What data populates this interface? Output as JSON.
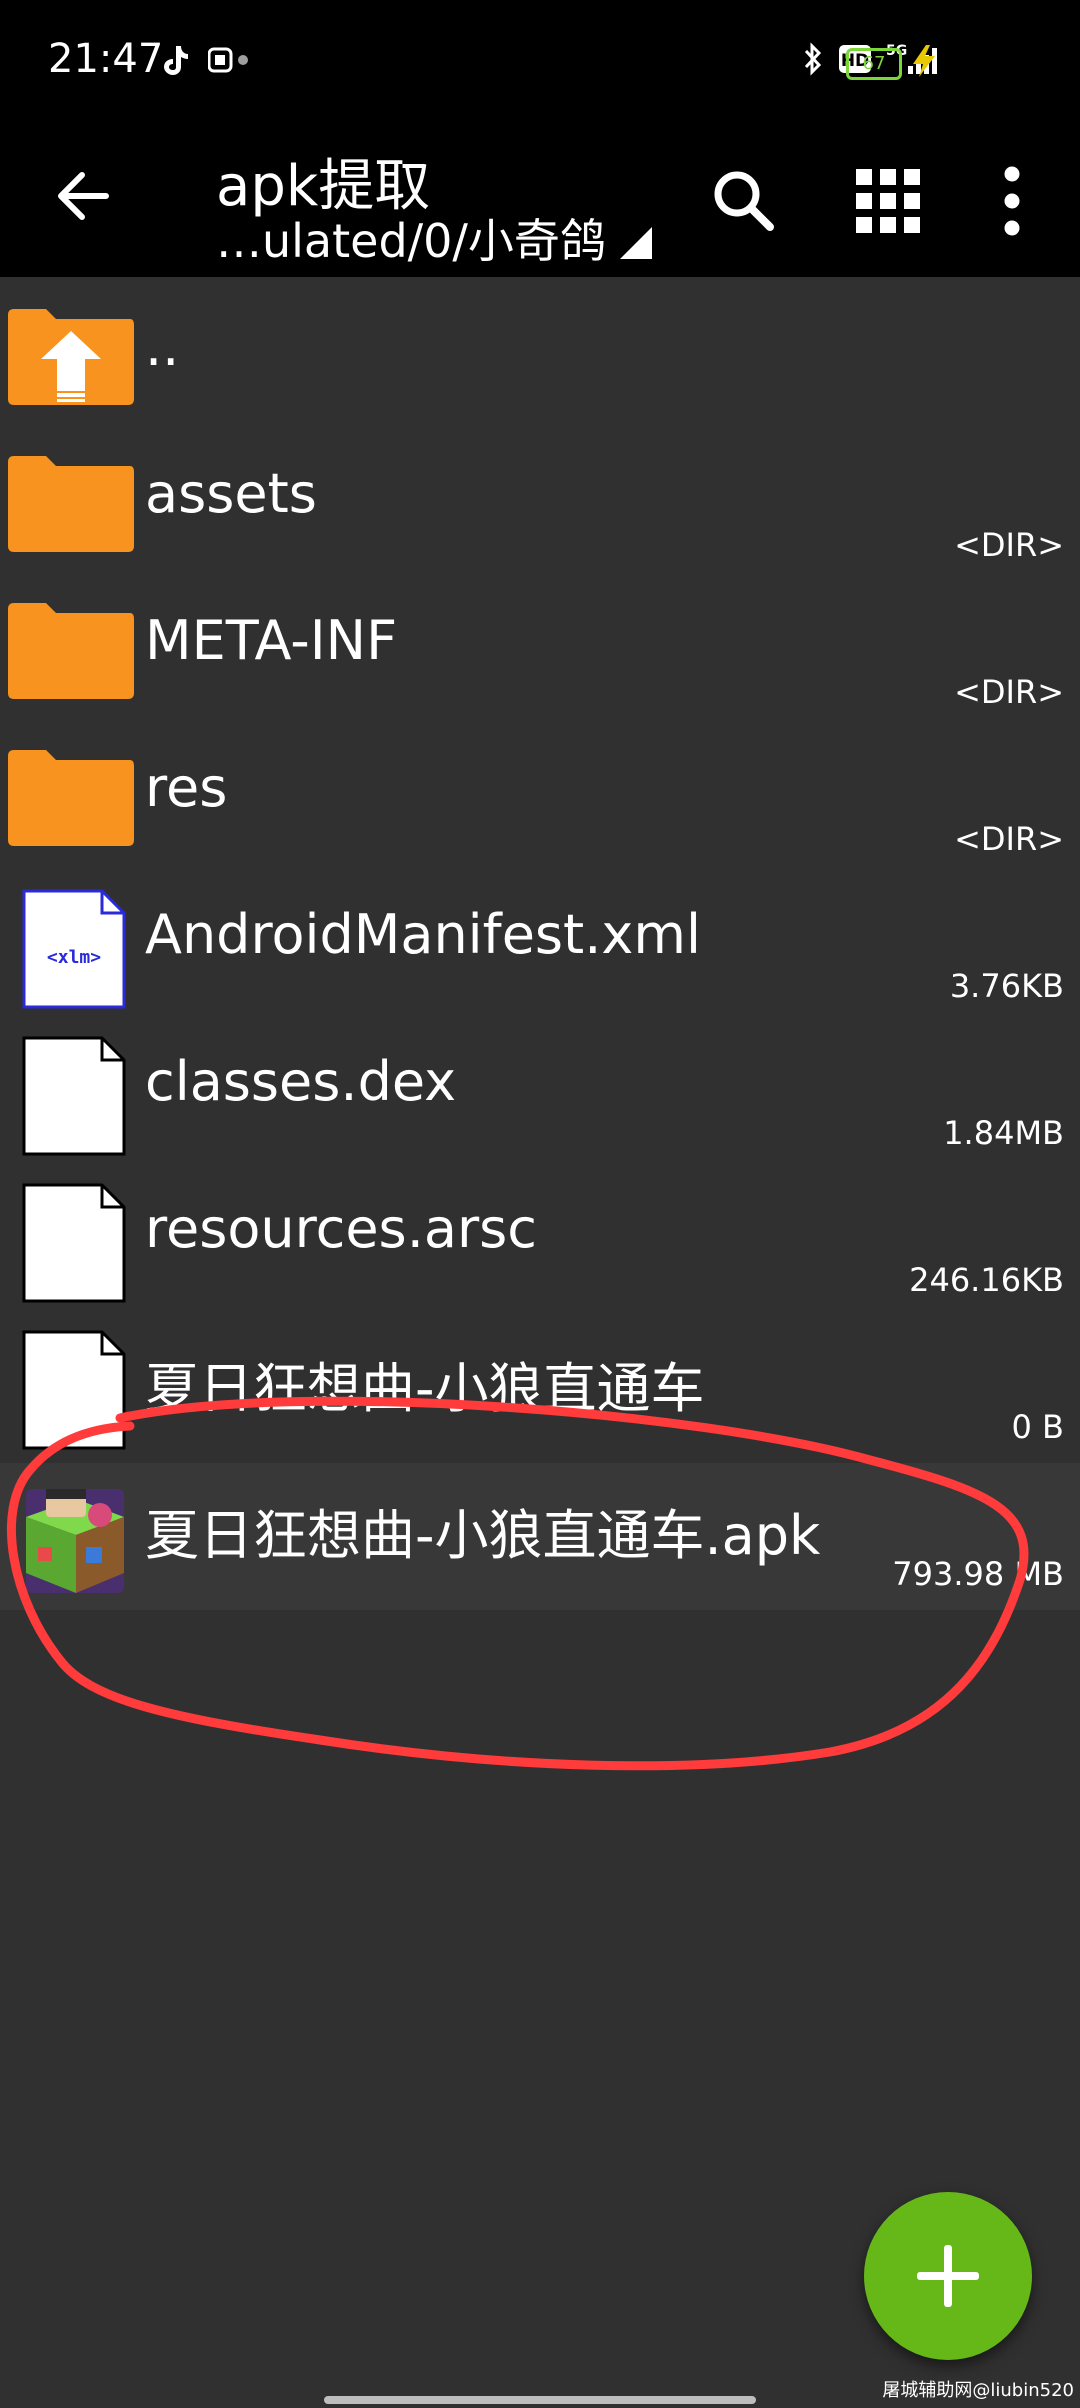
{
  "status_bar": {
    "time": "21:47",
    "battery": "67",
    "left_icons": [
      "tiktok-icon",
      "notification-icon"
    ],
    "right_icons": [
      "bluetooth-icon",
      "hd-icon",
      "signal-5g-icon"
    ]
  },
  "app_bar": {
    "title": "apk提取",
    "path": "…ulated/0/小奇鸽",
    "actions": [
      "search-icon",
      "grid-view-icon",
      "overflow-menu-icon"
    ]
  },
  "files": [
    {
      "name": "..",
      "meta": "",
      "icon": "parent-folder-icon"
    },
    {
      "name": "assets",
      "meta": "<DIR>",
      "icon": "folder-icon"
    },
    {
      "name": "META-INF",
      "meta": "<DIR>",
      "icon": "folder-icon"
    },
    {
      "name": "res",
      "meta": "<DIR>",
      "icon": "folder-icon"
    },
    {
      "name": "AndroidManifest.xml",
      "meta": "3.76KB",
      "icon": "xml-file-icon"
    },
    {
      "name": "classes.dex",
      "meta": "1.84MB",
      "icon": "file-icon"
    },
    {
      "name": "resources.arsc",
      "meta": "246.16KB",
      "icon": "file-icon"
    },
    {
      "name": "夏日狂想曲-小狼直通车",
      "meta": "0 B",
      "icon": "file-icon"
    },
    {
      "name": "夏日狂想曲-小狼直通车.apk",
      "meta": "793.98 MB",
      "icon": "apk-icon"
    }
  ],
  "fab": {
    "icon": "add-icon"
  },
  "watermark": "屠城辅助网@liubin520",
  "colors": {
    "background": "#303030",
    "bar": "#000000",
    "folder": "#f7931e",
    "fab": "#66b819",
    "annotation": "#ff3b3b"
  }
}
